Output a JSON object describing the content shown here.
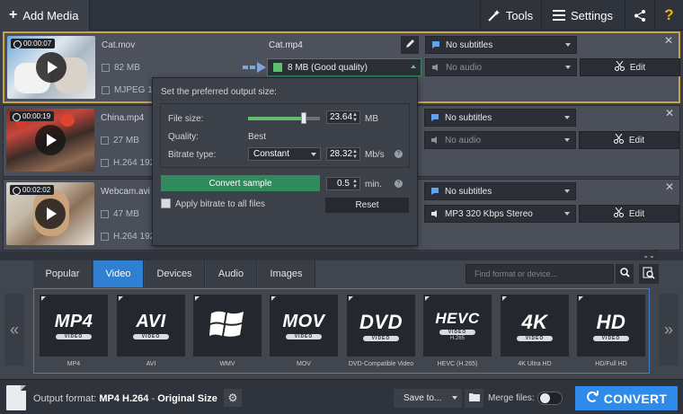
{
  "topbar": {
    "add_media": "Add Media",
    "tools": "Tools",
    "settings": "Settings"
  },
  "files": [
    {
      "duration": "00:00:07",
      "name": "Cat.mov",
      "size": "82 MB",
      "codec": "MJPEG 1920",
      "output_name": "Cat.mp4",
      "output_size": "8 MB (Good quality)",
      "subtitles": "No subtitles",
      "audio": "No audio",
      "edit": "Edit"
    },
    {
      "duration": "00:00:19",
      "name": "China.mp4",
      "size": "27 MB",
      "codec": "H.264 1920",
      "subtitles": "No subtitles",
      "audio": "No audio",
      "edit": "Edit"
    },
    {
      "duration": "00:02:02",
      "name": "Webcam.avi",
      "size": "47 MB",
      "codec": "H.264 1920x1080 2894 Kbps",
      "subtitles": "No subtitles",
      "audio": "MP3 320 Kbps Stereo",
      "edit": "Edit"
    }
  ],
  "popover": {
    "title": "Set the preferred output size:",
    "file_size_label": "File size:",
    "file_size_value": "23.64",
    "file_size_unit": "MB",
    "file_size_fraction": 0.78,
    "quality_label": "Quality:",
    "quality_value": "Best",
    "bitrate_label": "Bitrate type:",
    "bitrate_type": "Constant",
    "bitrate_value": "28.32",
    "bitrate_unit": "Mb/s",
    "convert_sample": "Convert sample",
    "sample_value": "0.5",
    "sample_unit": "min.",
    "apply_all": "Apply bitrate to all files",
    "reset": "Reset"
  },
  "tabs": [
    "Popular",
    "Video",
    "Devices",
    "Audio",
    "Images"
  ],
  "active_tab": "Video",
  "search_placeholder": "Find format or device...",
  "formats": [
    {
      "logo": "MP4",
      "sub": "VIDEO",
      "caption": "MP4"
    },
    {
      "logo": "AVI",
      "sub": "VIDEO",
      "caption": "AVI"
    },
    {
      "logo": "",
      "sub": "",
      "caption": "WMV",
      "icon": "windows-logo-icon"
    },
    {
      "logo": "MOV",
      "sub": "VIDEO",
      "caption": "MOV"
    },
    {
      "logo": "DVD",
      "sub": "VIDEO",
      "caption": "DVD-Compatible Video"
    },
    {
      "logo": "HEVC",
      "sub": "VIDEO",
      "extra": "H.265",
      "caption": "HEVC (H.265)"
    },
    {
      "logo": "4K",
      "sub": "VIDEO",
      "caption": "4K Ultra HD"
    },
    {
      "logo": "HD",
      "sub": "VIDEO",
      "caption": "HD/Full HD"
    }
  ],
  "bottom": {
    "output_label": "Output format:",
    "output_format": "MP4 H.264",
    "output_sep": " - ",
    "output_preset": "Original Size",
    "save_to": "Save to...",
    "merge_files": "Merge files:",
    "convert": "CONVERT"
  },
  "colors": {
    "accent_blue": "#2f8bea",
    "active_tab": "#2f7fd3",
    "selection_border": "#c9a24a",
    "green": "#2f8a5c"
  }
}
